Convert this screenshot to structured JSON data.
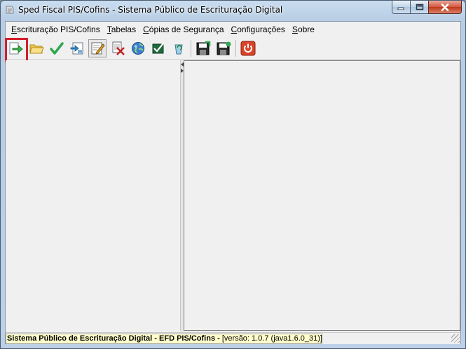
{
  "window": {
    "title": "Sped Fiscal PIS/Cofins - Sistema Público de Escrituração Digital"
  },
  "menu": {
    "items": [
      {
        "first": "E",
        "rest": "scrituração PIS/Cofins"
      },
      {
        "first": "T",
        "rest": "abelas"
      },
      {
        "first": "C",
        "rest": "ópias de Segurança"
      },
      {
        "first": "C",
        "rest": "onfigurações"
      },
      {
        "first": "S",
        "rest": "obre"
      }
    ]
  },
  "toolbar": {
    "icons": [
      "import-arrow-icon",
      "open-folder-icon",
      "validate-check-icon",
      "export-icon",
      "edit-signature-icon",
      "remove-document-icon",
      "transmit-globe-icon",
      "check-receipt-icon",
      "recycle-icon",
      "backup-save-icon",
      "restore-save-icon",
      "power-exit-icon"
    ],
    "highlight_color": "#d21f2a"
  },
  "status": {
    "title": "Sistema Público de Escrituração Digital - EFD PIS/Cofins -",
    "version": " [versão: 1.0.7 (java1.6.0_31)]"
  },
  "colors": {
    "status_bg": "#ffffcc",
    "close_button": "#c03818"
  }
}
